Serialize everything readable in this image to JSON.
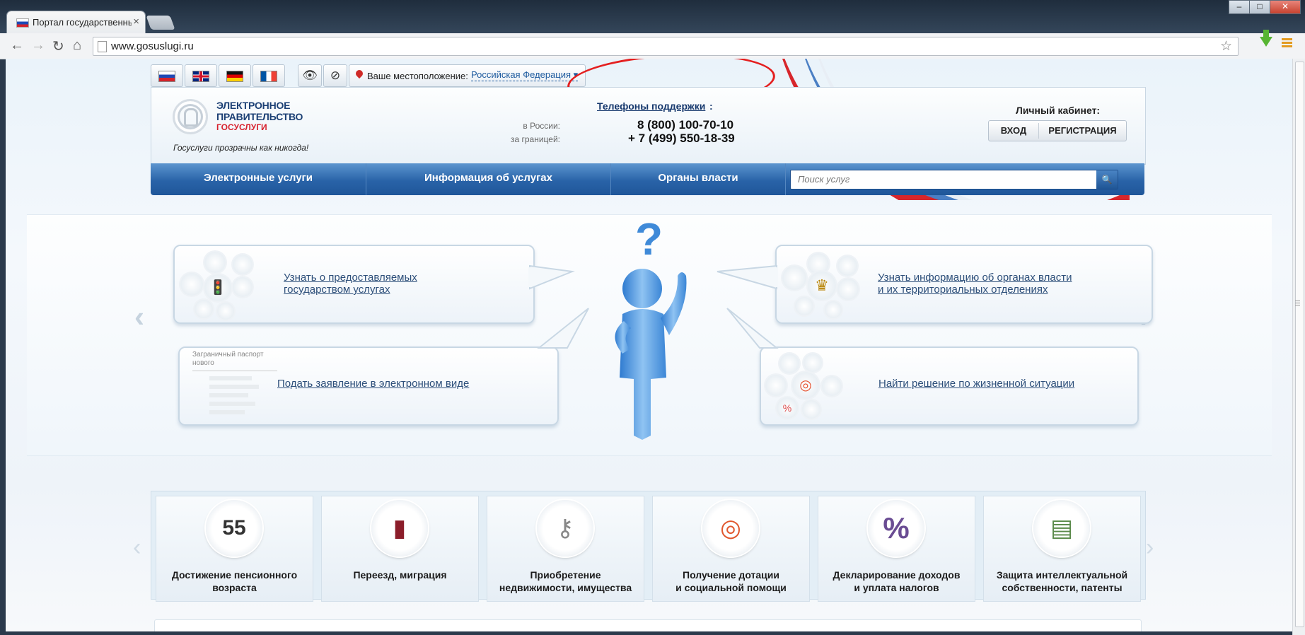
{
  "browser": {
    "tab_title": "Портал государственных",
    "url": "www.gosuslugi.ru"
  },
  "langs": [
    "ru-flag-icon",
    "uk-flag-icon",
    "de-flag-icon",
    "fr-flag-icon"
  ],
  "location": {
    "label": "Ваше местоположение:",
    "value": "Российская Федерация"
  },
  "logo": {
    "line1": "ЭЛЕКТРОННОЕ",
    "line2": "ПРАВИТЕЛЬСТВО",
    "line3": "ГОСУСЛУГИ",
    "tagline": "Госуслуги прозрачны как никогда!"
  },
  "support": {
    "title": "Телефоны поддержки",
    "colon": ":",
    "russia_label": "в России:",
    "russia_number": "8 (800) 100-70-10",
    "abroad_label": "за границей:",
    "abroad_number": "+ 7 (499) 550-18-39"
  },
  "cabinet": {
    "title": "Личный кабинет:",
    "login": "ВХОД",
    "register": "РЕГИСТРАЦИЯ"
  },
  "nav": {
    "items": [
      "Электронные услуги",
      "Информация об услугах",
      "Органы власти"
    ],
    "search_placeholder": "Поиск услуг"
  },
  "slider": {
    "bubble1": "Узнать о предоставляемых\nгосударством услугах",
    "bubble2": "Узнать информацию об органах власти\nи их территориальных отделениях",
    "bubble3": "Подать заявление в электронном виде",
    "bubble4": "Найти решение по жизненной ситуации",
    "doc_thumb_title": "Заграничный паспорт нового",
    "dots_total": 8,
    "dots_active_index": 2
  },
  "categories": [
    {
      "label": "Достижение пенсионного\nвозраста",
      "icon": "calendar-55-icon"
    },
    {
      "label": "Переезд, миграция",
      "icon": "passport-icon"
    },
    {
      "label": "Приобретение\nнедвижимости, имущества",
      "icon": "keys-icon"
    },
    {
      "label": "Получение дотации\nи социальной помощи",
      "icon": "lifebuoy-icon"
    },
    {
      "label": "Декларирование доходов\nи уплата налогов",
      "icon": "percent-icon"
    },
    {
      "label": "Защита интеллектуальной\nсобственности, патенты",
      "icon": "certificate-icon"
    }
  ]
}
